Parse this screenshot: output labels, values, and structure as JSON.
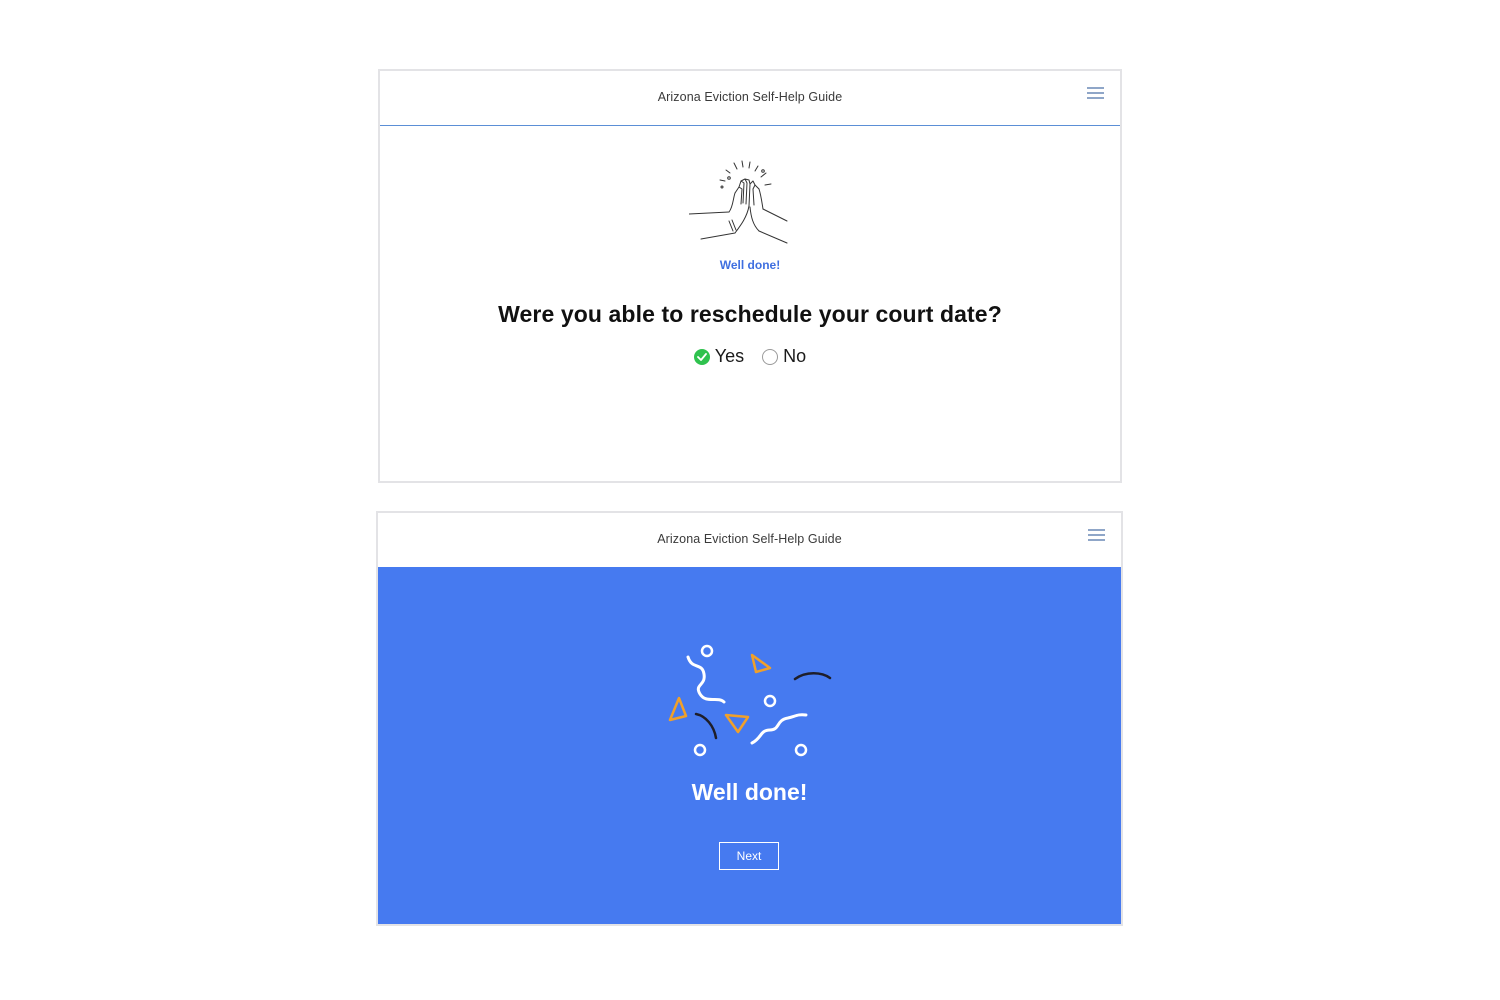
{
  "screens": [
    {
      "header": {
        "title": "Arizona Eviction Self-Help Guide",
        "menu_icon": "hamburger-menu-icon"
      },
      "illustration": {
        "icon": "high-five-icon",
        "caption": "Well done!",
        "caption_color": "#3f6fe0"
      },
      "question": "Were you able to reschedule your court date?",
      "options": [
        {
          "label": "Yes",
          "selected": true,
          "color": "#2fc24e"
        },
        {
          "label": "No",
          "selected": false
        }
      ]
    },
    {
      "header": {
        "title": "Arizona Eviction Self-Help Guide",
        "menu_icon": "hamburger-menu-icon"
      },
      "panel_color": "#467af0",
      "illustration": {
        "icon": "confetti-icon",
        "accent_colors": [
          "#f0a02a",
          "#1e1e2a",
          "#ffffff"
        ]
      },
      "caption": "Well done!",
      "next_label": "Next"
    }
  ]
}
